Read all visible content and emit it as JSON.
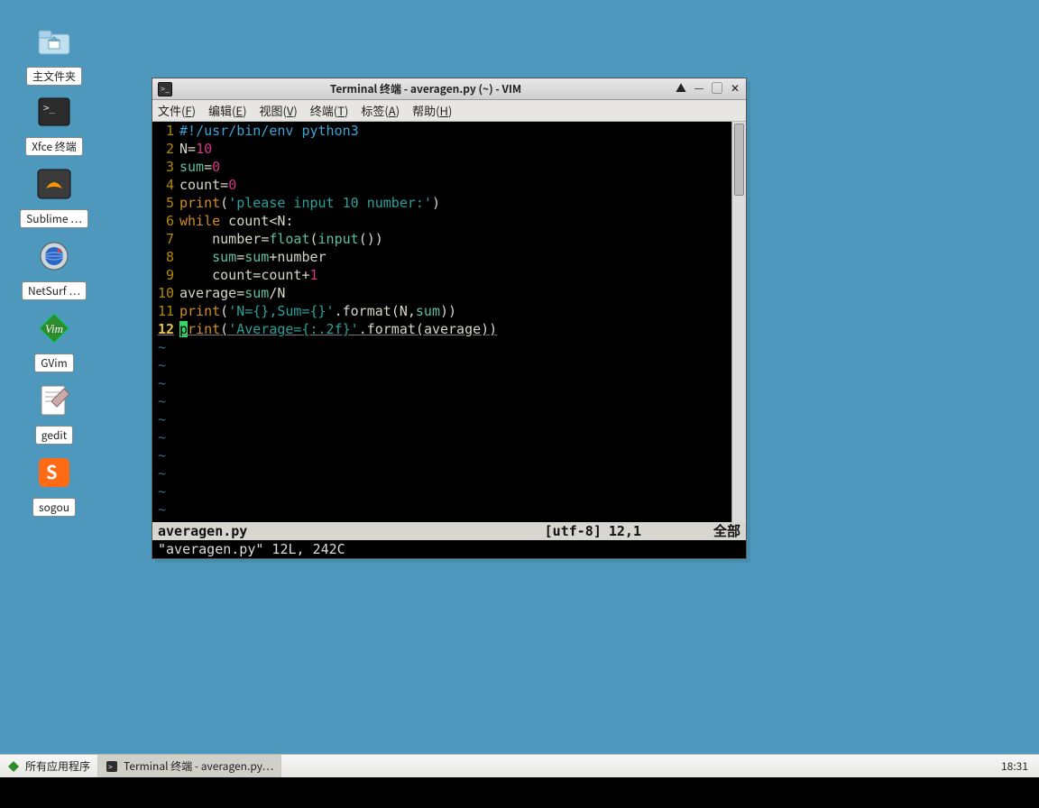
{
  "desktop": {
    "icons": [
      {
        "name": "home-folder",
        "label": "主文件夹"
      },
      {
        "name": "xfce-terminal",
        "label": "Xfce 终端"
      },
      {
        "name": "sublime-text",
        "label": "Sublime …"
      },
      {
        "name": "netsurf",
        "label": "NetSurf …"
      },
      {
        "name": "gvim",
        "label": "GVim"
      },
      {
        "name": "gedit",
        "label": "gedit"
      },
      {
        "name": "sogou",
        "label": "sogou"
      }
    ]
  },
  "window": {
    "title": "Terminal 终端 - averagen.py (~) - VIM",
    "menus": [
      "文件(F)",
      "编辑(E)",
      "视图(V)",
      "终端(T)",
      "标签(A)",
      "帮助(H)"
    ],
    "status": {
      "filename": "averagen.py",
      "encoding": "[utf-8]",
      "pos": "12,1",
      "scope": "全部",
      "msg": "\"averagen.py\" 12L, 242C"
    }
  },
  "code": {
    "lines": [
      {
        "n": "1",
        "raw": "#!/usr/bin/env python3"
      },
      {
        "n": "2",
        "raw": "N=10"
      },
      {
        "n": "3",
        "raw": "sum=0"
      },
      {
        "n": "4",
        "raw": "count=0"
      },
      {
        "n": "5",
        "raw": "print('please input 10 number:')"
      },
      {
        "n": "6",
        "raw": "while count<N:"
      },
      {
        "n": "7",
        "raw": "    number=float(input())"
      },
      {
        "n": "8",
        "raw": "    sum=sum+number"
      },
      {
        "n": "9",
        "raw": "    count=count+1"
      },
      {
        "n": "10",
        "raw": "average=sum/N"
      },
      {
        "n": "11",
        "raw": "print('N={},Sum={}'.format(N,sum))"
      },
      {
        "n": "12",
        "raw": "print('Average={:.2f}'.format(average))"
      }
    ],
    "cursor_line": 12
  },
  "taskbar": {
    "apps_button": "所有应用程序",
    "task": "Terminal 终端 - averagen.py…",
    "clock": "18:31"
  }
}
